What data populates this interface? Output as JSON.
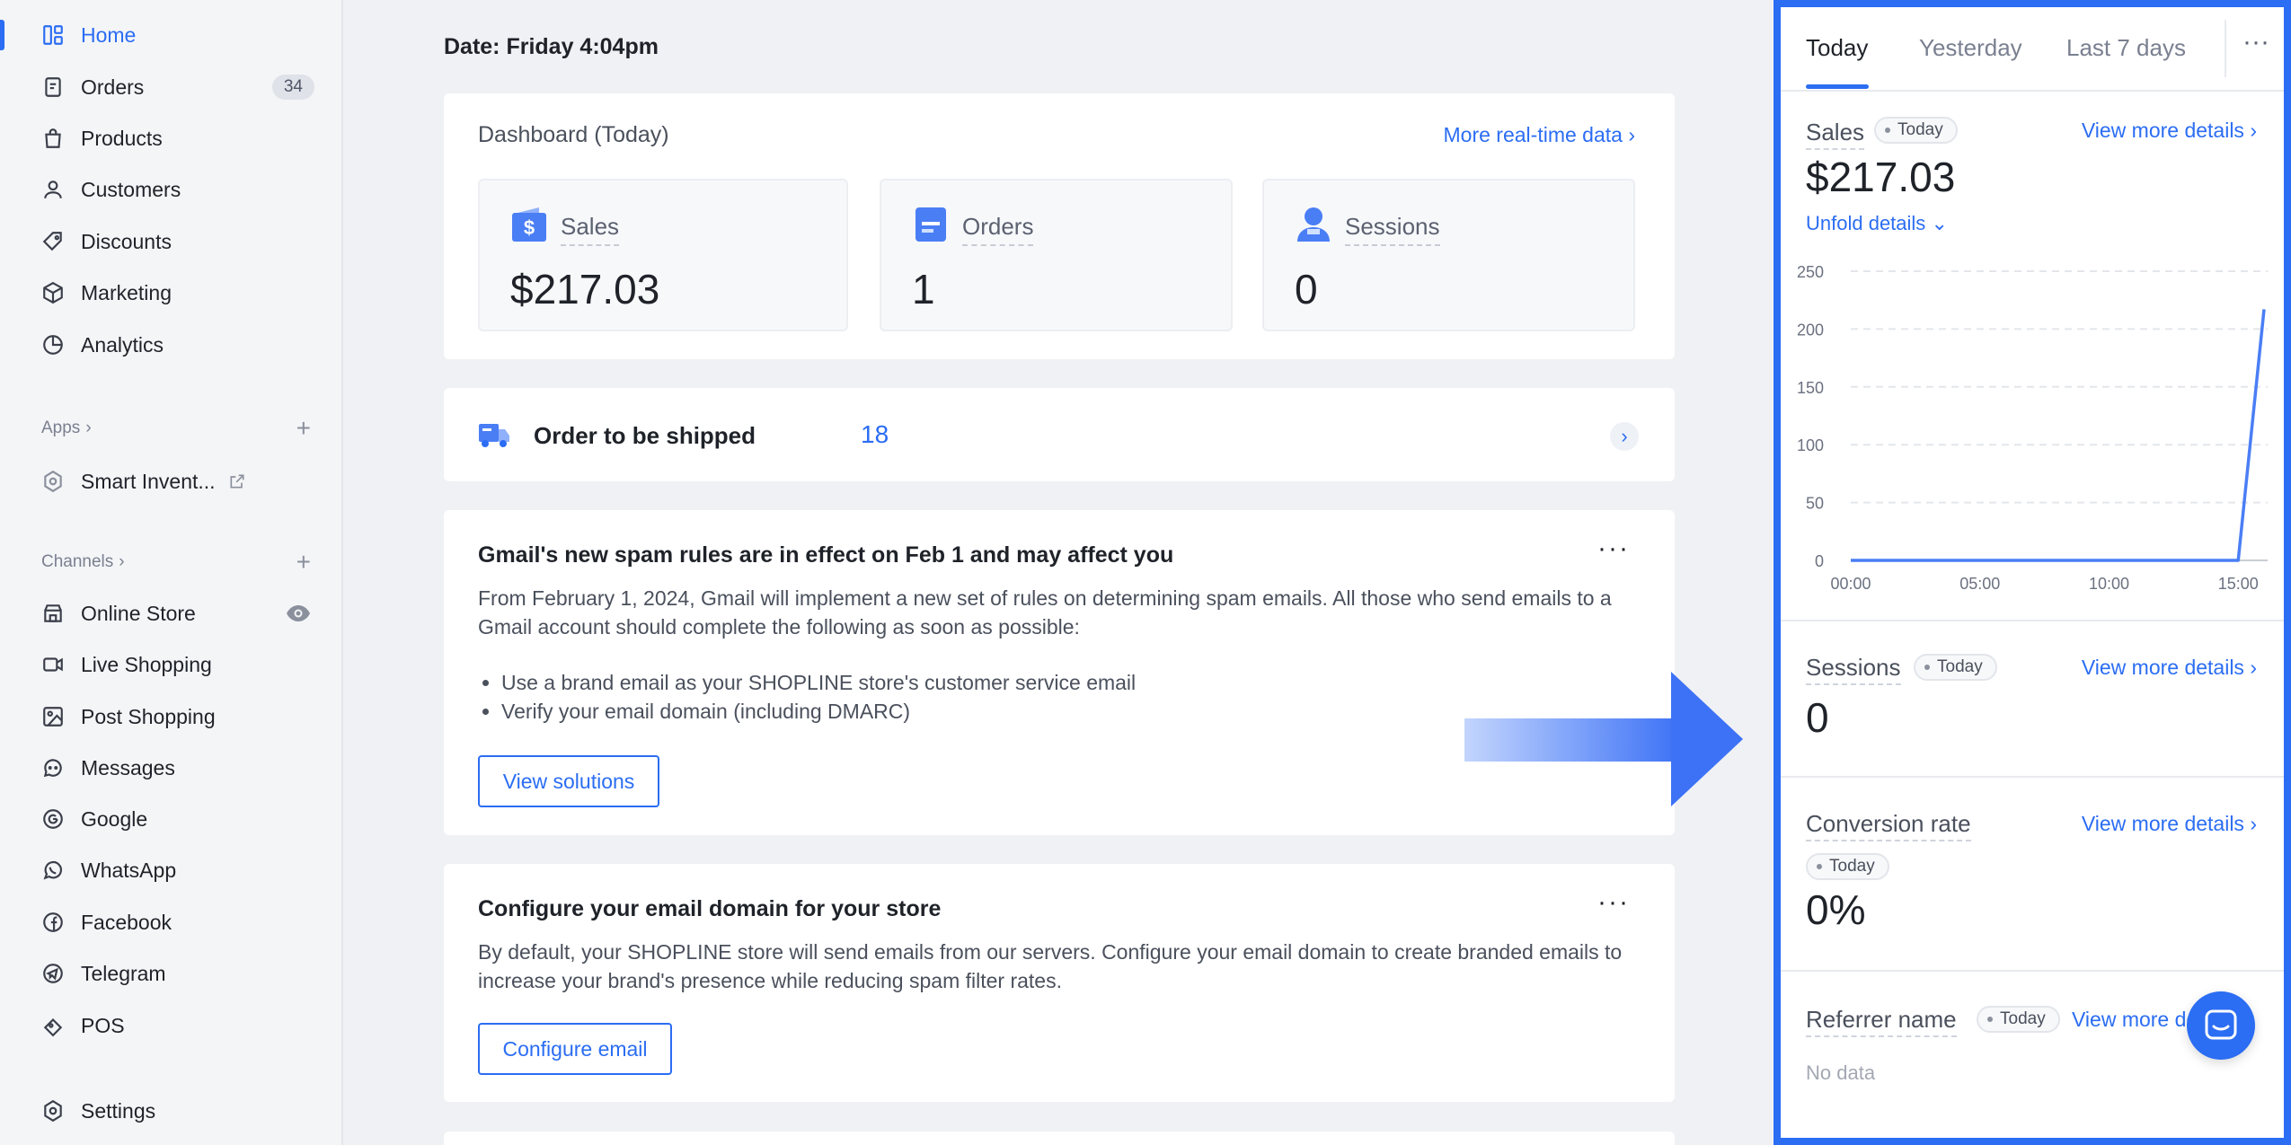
{
  "sidebar": {
    "items": [
      {
        "label": "Home",
        "icon": "home-icon"
      },
      {
        "label": "Orders",
        "icon": "orders-icon",
        "badge": "34"
      },
      {
        "label": "Products",
        "icon": "products-icon"
      },
      {
        "label": "Customers",
        "icon": "customers-icon"
      },
      {
        "label": "Discounts",
        "icon": "discounts-icon"
      },
      {
        "label": "Marketing",
        "icon": "marketing-icon"
      },
      {
        "label": "Analytics",
        "icon": "analytics-icon"
      }
    ],
    "apps_heading": "Apps",
    "apps": [
      {
        "label": "Smart Invent...",
        "icon": "smart-inventory-icon"
      }
    ],
    "channels_heading": "Channels",
    "channels": [
      {
        "label": "Online Store",
        "icon": "online-store-icon"
      },
      {
        "label": "Live Shopping",
        "icon": "live-shopping-icon"
      },
      {
        "label": "Post Shopping",
        "icon": "post-shopping-icon"
      },
      {
        "label": "Messages",
        "icon": "messages-icon"
      },
      {
        "label": "Google",
        "icon": "google-icon"
      },
      {
        "label": "WhatsApp",
        "icon": "whatsapp-icon"
      },
      {
        "label": "Facebook",
        "icon": "facebook-icon"
      },
      {
        "label": "Telegram",
        "icon": "telegram-icon"
      },
      {
        "label": "POS",
        "icon": "pos-icon"
      }
    ],
    "settings": "Settings"
  },
  "main": {
    "date": "Date: Friday 4:04pm",
    "dashboard": {
      "title": "Dashboard (Today)",
      "more_link": "More real-time data",
      "metrics": [
        {
          "label": "Sales",
          "value": "$217.03"
        },
        {
          "label": "Orders",
          "value": "1"
        },
        {
          "label": "Sessions",
          "value": "0"
        }
      ]
    },
    "shipping": {
      "label": "Order to be shipped",
      "count": "18"
    },
    "gmail_card": {
      "title": "Gmail's new spam rules are in effect on Feb 1 and may affect you",
      "body": "From February 1, 2024, Gmail will implement a new set of rules on determining spam emails. All those who send emails to a Gmail account should complete the following as soon as possible:",
      "bullets": [
        "Use a brand email as your SHOPLINE store's customer service email",
        "Verify your email domain (including DMARC)"
      ],
      "button": "View solutions"
    },
    "email_card": {
      "title": "Configure your email domain for your store",
      "body": "By default, your SHOPLINE store will send emails from our servers. Configure your email domain to create branded emails to increase your brand's presence while reducing spam filter rates.",
      "button": "Configure email"
    }
  },
  "panel": {
    "tabs": [
      "Today",
      "Yesterday",
      "Last 7 days"
    ],
    "more": "···",
    "sales": {
      "title": "Sales",
      "pill": "Today",
      "view_more": "View more details",
      "value": "$217.03",
      "unfold": "Unfold details"
    },
    "sessions": {
      "title": "Sessions",
      "pill": "Today",
      "view_more": "View more details",
      "value": "0"
    },
    "conversion": {
      "title": "Conversion rate",
      "pill": "Today",
      "view_more": "View more details",
      "value": "0%"
    },
    "referrer": {
      "title": "Referrer name",
      "pill": "Today",
      "view_more": "View more de",
      "empty": "No data"
    }
  },
  "chart_data": {
    "type": "line",
    "x": [
      "00:00",
      "01:00",
      "02:00",
      "03:00",
      "04:00",
      "05:00",
      "06:00",
      "07:00",
      "08:00",
      "09:00",
      "10:00",
      "11:00",
      "12:00",
      "13:00",
      "14:00",
      "15:00",
      "16:00"
    ],
    "x_tick_labels": [
      "00:00",
      "05:00",
      "10:00",
      "15:00"
    ],
    "series": [
      {
        "values": [
          0,
          0,
          0,
          0,
          0,
          0,
          0,
          0,
          0,
          0,
          0,
          0,
          0,
          0,
          0,
          0,
          217.03
        ]
      }
    ],
    "ylim": [
      0,
      250
    ],
    "y_ticks": [
      0,
      50,
      100,
      150,
      200,
      250
    ],
    "grid": true,
    "color": "#4a7ef5"
  },
  "colors": {
    "accent": "#2b6df3",
    "panel_border": "#2b6df3"
  }
}
